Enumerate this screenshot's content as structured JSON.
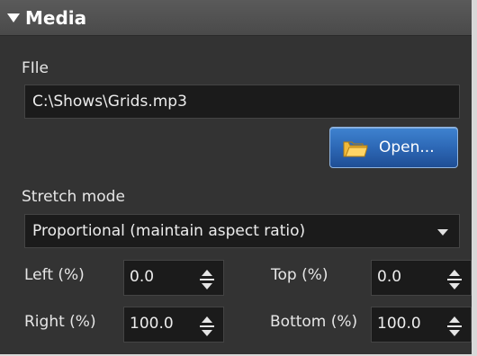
{
  "panel": {
    "title": "Media",
    "accent": "#3f83d0"
  },
  "file": {
    "label": "FIle",
    "value": "C:\\Shows\\Grids.mp3",
    "open_label": "Open..."
  },
  "stretch": {
    "label": "Stretch mode",
    "selected": "Proportional (maintain aspect ratio)"
  },
  "margins": {
    "left_label": "Left (%)",
    "left_value": "0.0",
    "top_label": "Top (%)",
    "top_value": "0.0",
    "right_label": "Right (%)",
    "right_value": "100.0",
    "bottom_label": "Bottom (%)",
    "bottom_value": "100.0"
  }
}
